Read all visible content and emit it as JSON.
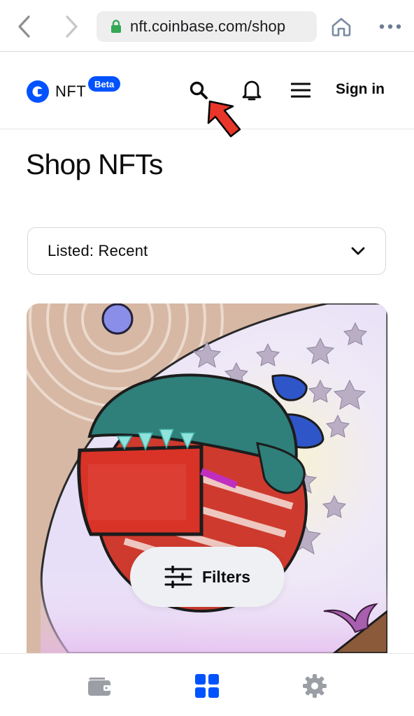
{
  "browser": {
    "url": "nft.coinbase.com/shop"
  },
  "header": {
    "logo_text": "NFT",
    "beta_label": "Beta",
    "signin_label": "Sign in"
  },
  "main": {
    "title": "Shop NFTs",
    "sort_select": {
      "value": "Listed: Recent"
    },
    "filters_label": "Filters"
  },
  "colors": {
    "brand_blue": "#0052ff",
    "lock_green": "#34a853",
    "pointer_red": "#e8362b",
    "icon_gray": "#9b9ea5"
  },
  "icons": {
    "back": "chevron-left-icon",
    "forward": "chevron-right-icon",
    "lock": "lock-icon",
    "home": "home-icon",
    "more": "more-horizontal-icon",
    "search": "search-icon",
    "bell": "bell-icon",
    "menu": "hamburger-menu-icon",
    "chevron": "chevron-down-icon",
    "filters": "sliders-icon",
    "wallet": "wallet-icon",
    "grid": "grid-icon",
    "settings": "gear-icon"
  }
}
